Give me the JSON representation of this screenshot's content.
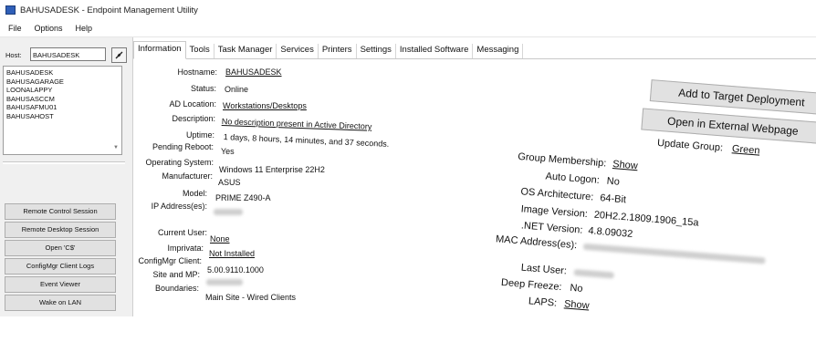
{
  "window": {
    "title": "BAHUSADESK - Endpoint Management Utility"
  },
  "menu": [
    "File",
    "Options",
    "Help"
  ],
  "host": {
    "label": "Host:",
    "value": "BAHUSADESK"
  },
  "host_list": [
    "BAHUSADESK",
    "BAHUSAGARAGE",
    "LOONALAPPY",
    "BAHUSASCCM",
    "BAHUSAFMU01",
    "BAHUSAHOST"
  ],
  "actions": [
    "Remote Control Session",
    "Remote Desktop Session",
    "Open 'C$'",
    "ConfigMgr Client Logs",
    "Event Viewer",
    "Wake on LAN"
  ],
  "tabs": [
    "Information",
    "Tools",
    "Task Manager",
    "Services",
    "Printers",
    "Settings",
    "Installed Software",
    "Messaging"
  ],
  "info": {
    "hostname": {
      "label": "Hostname:",
      "value": "BAHUSADESK"
    },
    "status": {
      "label": "Status:",
      "value": "Online"
    },
    "ad_location": {
      "label": "AD Location:",
      "value": "Workstations/Desktops"
    },
    "description": {
      "label": "Description:",
      "value": "No description present in Active Directory"
    },
    "uptime": {
      "label": "Uptime:",
      "value": "1 days, 8 hours, 14 minutes, and 37 seconds."
    },
    "pending_reboot": {
      "label": "Pending Reboot:",
      "value": "Yes"
    },
    "os": {
      "label": "Operating System:",
      "value": "Windows 11 Enterprise 22H2"
    },
    "manufacturer": {
      "label": "Manufacturer:",
      "value": "ASUS"
    },
    "model": {
      "label": "Model:",
      "value": "PRIME Z490-A"
    },
    "ip": {
      "label": "IP Address(es):",
      "value": ""
    },
    "current_user": {
      "label": "Current User:",
      "value": "None"
    },
    "imprivata": {
      "label": "Imprivata:",
      "value": "Not Installed"
    },
    "configmgr": {
      "label": "ConfigMgr Client:",
      "value": "5.00.9110.1000"
    },
    "site_mp": {
      "label": "Site and MP:",
      "value": ""
    },
    "boundaries": {
      "label": "Boundaries:",
      "value": "Main Site - Wired Clients"
    }
  },
  "right": {
    "add_target": "Add to Target Deployment",
    "open_external": "Open in External Webpage",
    "update_group": {
      "label": "Update Group:",
      "value": "Green"
    },
    "group_membership": {
      "label": "Group Membership:",
      "value": "Show"
    },
    "auto_logon": {
      "label": "Auto Logon:",
      "value": "No"
    },
    "os_arch": {
      "label": "OS Architecture:",
      "value": "64-Bit"
    },
    "image_version": {
      "label": "Image Version:",
      "value": "20H2.2.1809.1906_15a"
    },
    "dotnet": {
      "label": ".NET Version:",
      "value": "4.8.09032"
    },
    "mac": {
      "label": "MAC Address(es):",
      "value": ""
    },
    "last_user": {
      "label": "Last User:",
      "value": ""
    },
    "deep_freeze": {
      "label": "Deep Freeze:",
      "value": "No"
    },
    "laps": {
      "label": "LAPS:",
      "value": "Show"
    }
  }
}
